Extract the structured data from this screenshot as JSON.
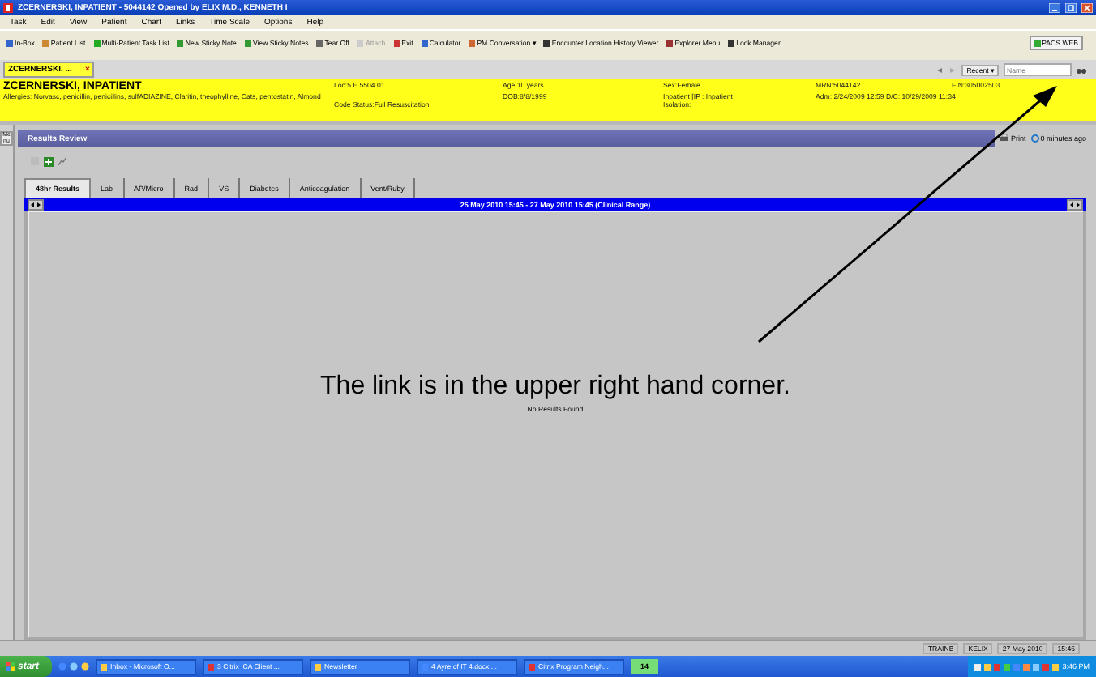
{
  "window": {
    "title": "ZCERNERSKI, INPATIENT - 5044142 Opened by ELIX M.D., KENNETH I"
  },
  "menu": [
    "Task",
    "Edit",
    "View",
    "Patient",
    "Chart",
    "Links",
    "Time Scale",
    "Options",
    "Help"
  ],
  "toolbar": [
    {
      "label": "In-Box",
      "disabled": false
    },
    {
      "label": "Patient List",
      "disabled": false
    },
    {
      "label": "Multi-Patient Task List",
      "disabled": false
    },
    {
      "label": "New Sticky Note",
      "disabled": false
    },
    {
      "label": "View Sticky Notes",
      "disabled": false
    },
    {
      "label": "Tear Off",
      "disabled": false
    },
    {
      "label": "Attach",
      "disabled": true
    },
    {
      "label": "Exit",
      "disabled": false
    },
    {
      "label": "Calculator",
      "disabled": false
    },
    {
      "label": "PM Conversation ▾",
      "disabled": false
    },
    {
      "label": "Encounter Location History Viewer",
      "disabled": false
    },
    {
      "label": "Explorer Menu",
      "disabled": false
    },
    {
      "label": "Lock Manager",
      "disabled": false
    },
    {
      "label": "PACS WEB",
      "disabled": false
    }
  ],
  "patient_tab": {
    "label": "ZCERNERSKI, ...",
    "close": "×"
  },
  "recent": {
    "label": "Recent ▾"
  },
  "search": {
    "placeholder": "Name"
  },
  "banner": {
    "name": "ZCERNERSKI, INPATIENT",
    "allergies": "Allergies: Norvasc, penicillin, penicillins, sulfADIAZINE, Claritin, theophylline, Cats, pentostatin, Almond",
    "location": "Loc:5 E 5504 01",
    "code_status": "Code Status:Full Resuscitation",
    "age": "Age:10 years",
    "dob": "DOB:8/8/1999",
    "sex": "Sex:Female",
    "encounter_type": "Inpatient [IP : Inpatient",
    "isolation": "Isolation:",
    "mrn": "MRN:5044142",
    "admission": "Adm: 2/24/2009 12:59 D/C: 10/29/2009 11:34",
    "fin": "FIN:305002503"
  },
  "side_tab": "Menu",
  "results_review": {
    "title": "Results Review",
    "print": "Print",
    "updated": "0 minutes ago",
    "tabs": [
      {
        "label": "48hr Results",
        "selected": true
      },
      {
        "label": "Lab",
        "selected": false
      },
      {
        "label": "AP/Micro",
        "selected": false
      },
      {
        "label": "Rad",
        "selected": false
      },
      {
        "label": "VS",
        "selected": false
      },
      {
        "label": "Diabetes",
        "selected": false
      },
      {
        "label": "Anticoagulation",
        "selected": false
      },
      {
        "label": "Vent/Ruby",
        "selected": false
      }
    ],
    "date_range": "25 May 2010 15:45 - 27 May 2010 15:45 (Clinical Range)",
    "empty_message": "No Results Found"
  },
  "annotation": "The link is in the upper right hand corner.",
  "status_bar": [
    "TRAINB",
    "KELIX",
    "27 May 2010",
    "15:46"
  ],
  "taskbar": {
    "start": "start",
    "items": [
      "Inbox - Microsoft O...",
      "3 Citrix ICA Client ...",
      "Newsletter",
      "4 Ayre of IT 4.docx ...",
      "Citrix Program Neigh..."
    ],
    "badge": "14",
    "clock": "3:46 PM"
  }
}
